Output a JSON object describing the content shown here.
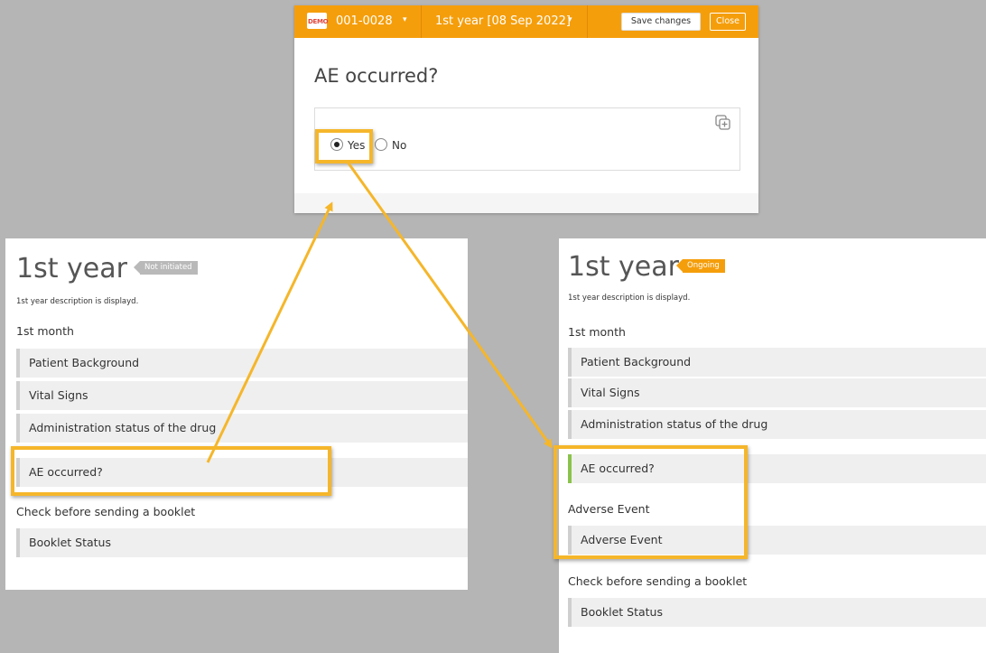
{
  "dialog": {
    "demo_badge": "DEMO",
    "subject_id": "001-0028",
    "visit": "1st year [08 Sep 2022]",
    "save_label": "Save changes",
    "close_label": "Close",
    "title": "AE occurred?",
    "options": [
      "Yes",
      "No"
    ],
    "selected": "Yes",
    "copy_icon": "copy-add-icon"
  },
  "left_panel": {
    "title": "1st year",
    "status": "Not initiated",
    "status_color": "#b9b9b9",
    "description": "1st year description is displayd.",
    "sections": [
      {
        "heading": "1st month",
        "items": [
          "Patient Background",
          "Vital Signs",
          "Administration status of the drug",
          "AE occurred?"
        ]
      },
      {
        "heading": "Check before sending a booklet",
        "items": [
          "Booklet Status"
        ]
      }
    ]
  },
  "right_panel": {
    "title": "1st year",
    "status": "Ongoing",
    "status_color": "#f59e0b",
    "description": "1st year description is displayd.",
    "sections": [
      {
        "heading": "1st month",
        "items": [
          "Patient Background",
          "Vital Signs",
          "Administration status of the drug",
          "AE occurred?"
        ]
      },
      {
        "heading": "Adverse Event",
        "items": [
          "Adverse Event"
        ]
      },
      {
        "heading": "Check before sending a booklet",
        "items": [
          "Booklet Status"
        ]
      }
    ]
  },
  "colors": {
    "accent": "#f59e0b",
    "highlight": "#f5b62a",
    "complete_marker": "#8bc34a",
    "backdrop": "#b5b5b5"
  }
}
